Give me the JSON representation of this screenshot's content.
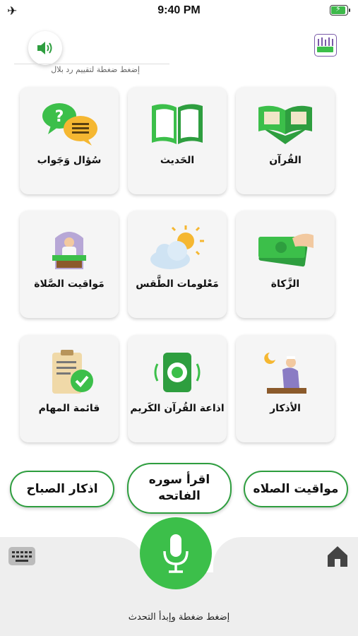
{
  "status_bar": {
    "time": "9:40 PM",
    "airplane_icon": "airplane-icon",
    "battery_icon": "battery-charging-icon"
  },
  "header": {
    "speaker_icon": "speaker-icon",
    "rating_hint": "إضغط ضغطة لتقييم رد بلال",
    "logo_icon": "bilal-logo-icon"
  },
  "tiles": [
    {
      "label": "القُرآن",
      "icon": "quran-icon"
    },
    {
      "label": "الحَديث",
      "icon": "open-book-icon"
    },
    {
      "label": "سُؤال وَجَواب",
      "icon": "question-answer-icon"
    },
    {
      "label": "الزَّكاة",
      "icon": "money-hand-icon"
    },
    {
      "label": "مَعْلومات الطَّقس",
      "icon": "weather-icon"
    },
    {
      "label": "مَواقيت الصَّلاة",
      "icon": "mosque-person-icon"
    },
    {
      "label": "الأذكار",
      "icon": "praying-person-icon"
    },
    {
      "label": "اذاعة القُرآن الكَريم",
      "icon": "radio-speaker-icon"
    },
    {
      "label": "قائمة المهام",
      "icon": "clipboard-check-icon"
    }
  ],
  "quick_actions": {
    "right": "مواقيت الصلاه",
    "middle_line1": "اقرأ سوره",
    "middle_line2": "الفاتحه",
    "left": "اذكار الصباح"
  },
  "bottom_bar": {
    "mic_icon": "microphone-icon",
    "keyboard_icon": "keyboard-icon",
    "home_icon": "home-icon",
    "speak_hint": "إضغط ضغطة وإبدأ التحدث"
  },
  "colors": {
    "accent_green": "#3cbf4a",
    "border_green": "#2e9e3f",
    "tile_bg": "#f5f5f5",
    "panel_bg": "#eeeeee"
  }
}
